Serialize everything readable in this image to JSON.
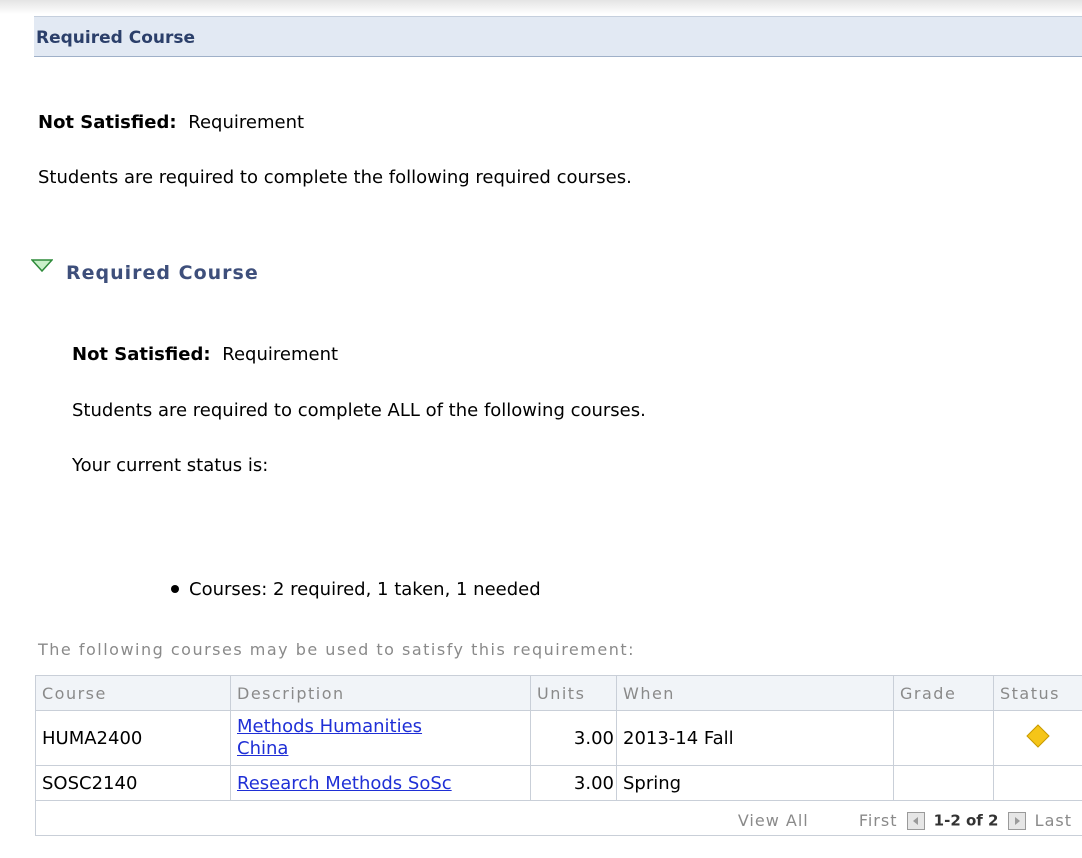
{
  "header": {
    "title": "Required Course"
  },
  "requirement": {
    "status_label": "Not Satisfied:",
    "status_value": "Requirement",
    "description": "Students are required to complete the following required courses."
  },
  "sub_requirement": {
    "title": "Required Course",
    "status_label": "Not Satisfied:",
    "status_value": "Requirement",
    "description": "Students are required to complete ALL of the following courses.",
    "current_status_label": "Your current status is:",
    "status_bullet": "Courses: 2 required, 1 taken, 1 needed"
  },
  "courses": {
    "caption": "The following courses may be used to satisfy this requirement:",
    "columns": [
      "Course",
      "Description",
      "Units",
      "When",
      "Grade",
      "Status"
    ],
    "rows": [
      {
        "course": "HUMA2400",
        "description_line1": "Methods Humanities",
        "description_line2": "China",
        "units": "3.00",
        "when": "2013-14 Fall",
        "grade": "",
        "status_icon": "in-progress-diamond-icon"
      },
      {
        "course": "SOSC2140",
        "description_line1": "Research Methods SoSc",
        "description_line2": "",
        "units": "3.00",
        "when": "Spring",
        "grade": "",
        "status_icon": ""
      }
    ],
    "pager": {
      "view_all": "View All",
      "first": "First",
      "range": "1-2 of 2",
      "last": "Last"
    }
  },
  "colors": {
    "header_bg": "#e2e9f3",
    "header_text": "#2b3f6a",
    "link": "#1f2fd6",
    "status_diamond": "#f5c518"
  }
}
